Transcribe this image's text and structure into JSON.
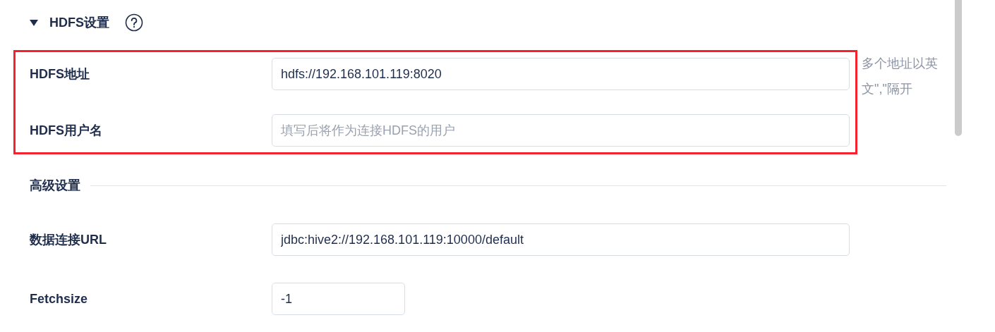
{
  "sections": [
    {
      "kind": "collapsible",
      "title": "HDFS设置",
      "expanded": true,
      "help": true,
      "highlighted": true,
      "fields": [
        {
          "label": "HDFS地址",
          "value": "hdfs://192.168.101.119:8020",
          "hint": "多个地址以英文\",\"隔开",
          "kind": "long"
        },
        {
          "label": "HDFS用户名",
          "placeholder": "填写后将作为连接HDFS的用户",
          "kind": "long"
        }
      ]
    },
    {
      "kind": "divider",
      "title": "高级设置",
      "fields": [
        {
          "label": "数据连接URL",
          "value": "jdbc:hive2://192.168.101.119:10000/default",
          "kind": "long"
        },
        {
          "label": "Fetchsize",
          "value": "-1",
          "kind": "short"
        }
      ]
    }
  ]
}
